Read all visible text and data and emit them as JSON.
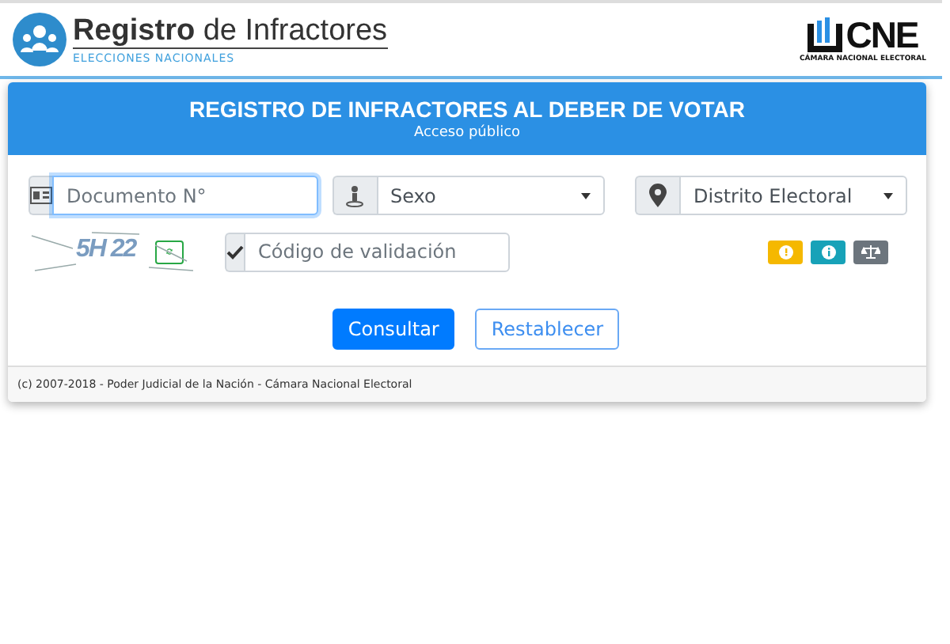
{
  "header": {
    "title_bold": "Registro",
    "title_rest": "de Infractores",
    "subtitle": "ELECCIONES NACIONALES",
    "org_logo": "CNE",
    "org_name": "CÁMARA NACIONAL ELECTORAL"
  },
  "card": {
    "title": "REGISTRO DE INFRACTORES AL DEBER DE VOTAR",
    "subtitle": "Acceso público"
  },
  "fields": [
    {
      "kind": "input",
      "placeholder": "Documento N°",
      "focused": true
    },
    {
      "kind": "select",
      "value": "Sexo"
    },
    {
      "kind": "select",
      "value": "Distrito Electoral"
    }
  ],
  "captcha": {
    "text": "5H 22",
    "placeholder": "Código de validación"
  },
  "info_buttons": [
    {
      "kind": "help",
      "color": "#f5b800"
    },
    {
      "kind": "info",
      "color": "#17a2b8"
    },
    {
      "kind": "law",
      "color": "#6c757d"
    }
  ],
  "buttons": [
    {
      "label": "Consultar",
      "primary": true
    },
    {
      "label": "Restablecer",
      "primary": false
    }
  ],
  "footer": "(c) 2007-2018 - Poder Judicial de la Nación - Cámara Nacional Electoral"
}
